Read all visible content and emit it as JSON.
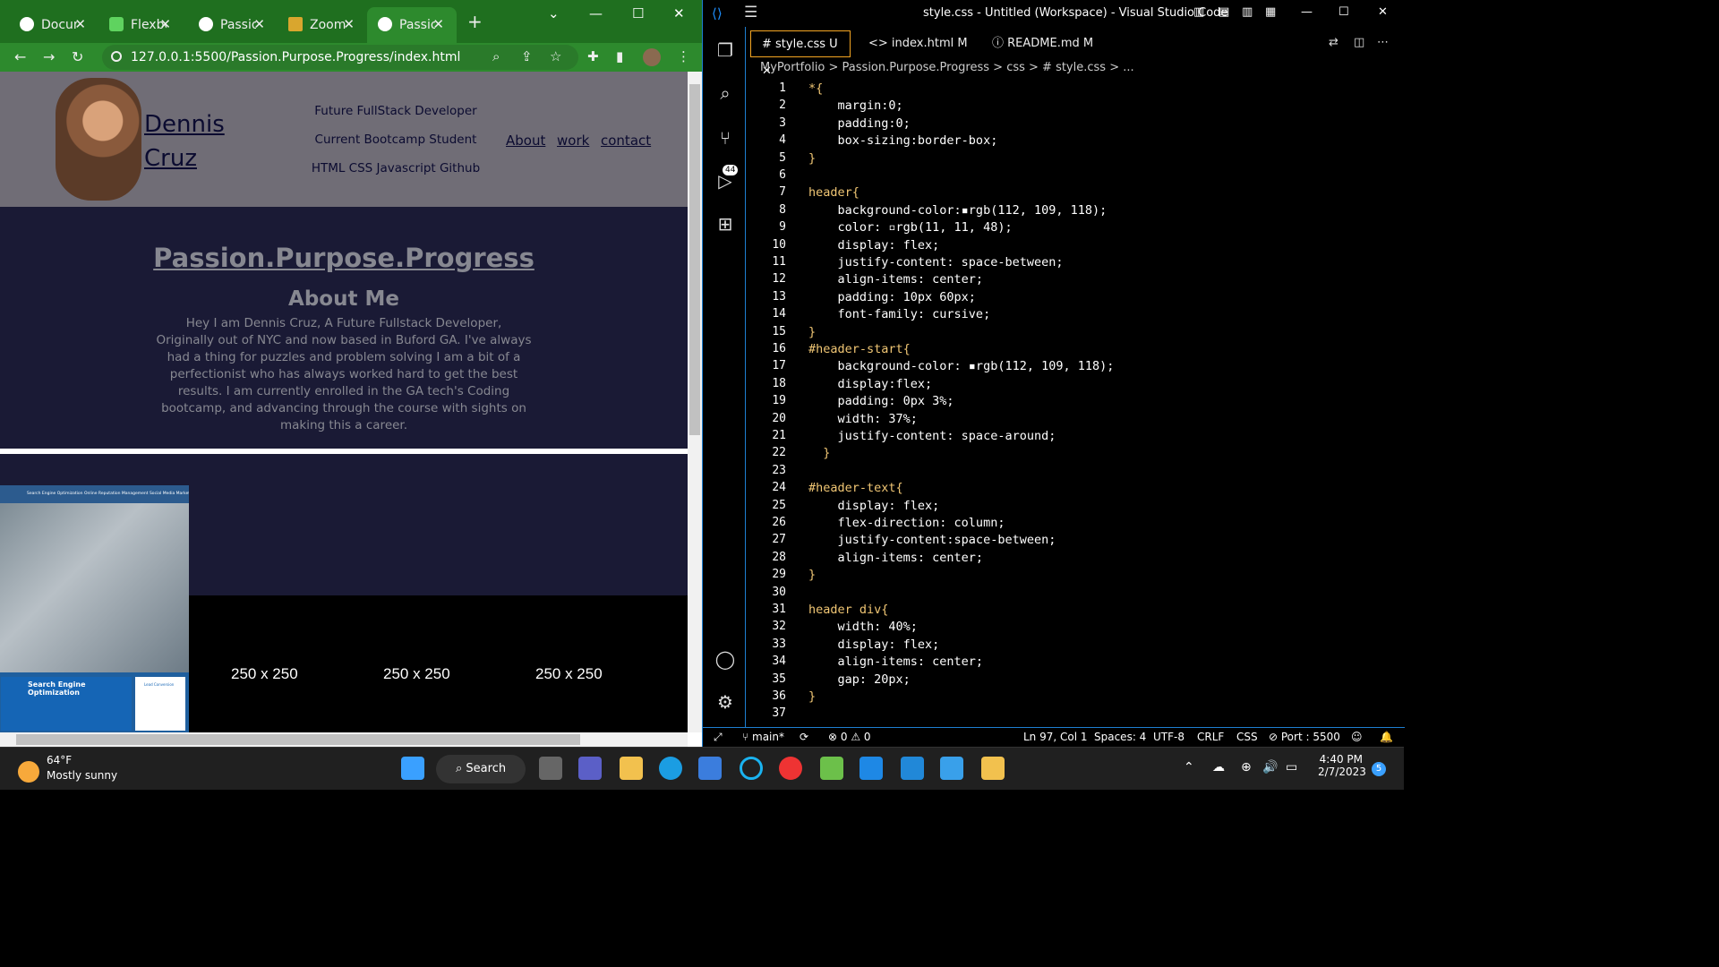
{
  "chrome": {
    "tabs": [
      {
        "title": "Docun",
        "left": 0
      },
      {
        "title": "Flexbc"
      },
      {
        "title": "Passio"
      },
      {
        "title": "Zoom"
      },
      {
        "title": "Passio"
      }
    ],
    "url": "127.0.0.1:5500/Passion.Purpose.Progress/index.html"
  },
  "site": {
    "name_line1": "Dennis",
    "name_line2": "Cruz",
    "header_lines": [
      "Future FullStack Developer",
      "Current Bootcamp Student",
      "HTML CSS Javascript Github"
    ],
    "nav": [
      "About",
      "work",
      "contact"
    ],
    "title": "Passion.Purpose.Progress",
    "about_title": "About Me",
    "about_text": "Hey I am Dennis Cruz, A Future Fullstack Developer, Originally out of NYC and now based in Buford GA. I've always had a thing for puzzles and problem solving I am a bit of a perfectionist who has always worked hard to get the best results. I am currently enrolled in the GA tech's Coding bootcamp, and advancing through the course with sights on making this a career.",
    "seo_top": "Search Engine Optimization    Online Reputation Management    Social Media Marketing",
    "seo_block": "Search Engine Optimization",
    "seo_block2": "Lead Conversion",
    "placeholders": [
      "250 x 250",
      "250 x 250",
      "250 x 250"
    ]
  },
  "vscode": {
    "title": "style.css - Untitled (Workspace) - Visual Studio Code",
    "tabs": [
      {
        "label": "# style.css",
        "status": "U"
      },
      {
        "label": "<> index.html",
        "status": "M"
      },
      {
        "label": "ⓘ README.md",
        "status": "M"
      }
    ],
    "breadcrumb": "MyPortfolio > Passion.Purpose.Progress > css > # style.css > ...",
    "badge": "44",
    "lines": [
      "*{",
      "    margin:0;",
      "    padding:0;",
      "    box-sizing:border-box;",
      "}",
      "",
      "header{",
      "    background-color:▪rgb(112, 109, 118);",
      "    color: ▫rgb(11, 11, 48);",
      "    display: flex;",
      "    justify-content: space-between;",
      "    align-items: center;",
      "    padding: 10px 60px;",
      "    font-family: cursive;",
      "}",
      "#header-start{",
      "    background-color: ▪rgb(112, 109, 118);",
      "    display:flex;",
      "    padding: 0px 3%;",
      "    width: 37%;",
      "    justify-content: space-around;",
      "  }",
      "",
      "#header-text{",
      "    display: flex;",
      "    flex-direction: column;",
      "    justify-content:space-between;",
      "    align-items: center;",
      "}",
      "",
      "header div{",
      "    width: 40%;",
      "    display: flex;",
      "    align-items: center;",
      "    gap: 20px;",
      "}",
      ""
    ],
    "status": {
      "branch": "main*",
      "problems": "⊗ 0 ⚠ 0",
      "position": "Ln 97, Col 1",
      "spaces": "Spaces: 4",
      "encoding": "UTF-8",
      "eol": "CRLF",
      "lang": "CSS",
      "port": "⊘ Port : 5500"
    }
  },
  "taskbar": {
    "temp": "64°F",
    "condition": "Mostly sunny",
    "search": "Search",
    "time": "4:40 PM",
    "date": "2/7/2023",
    "notif": "5"
  },
  "colors": {
    "chrome_green": "#2d8a2d",
    "site_header": "#706d76",
    "site_bg": "#1a1a35",
    "vscode_accent": "#1e7fd1"
  }
}
